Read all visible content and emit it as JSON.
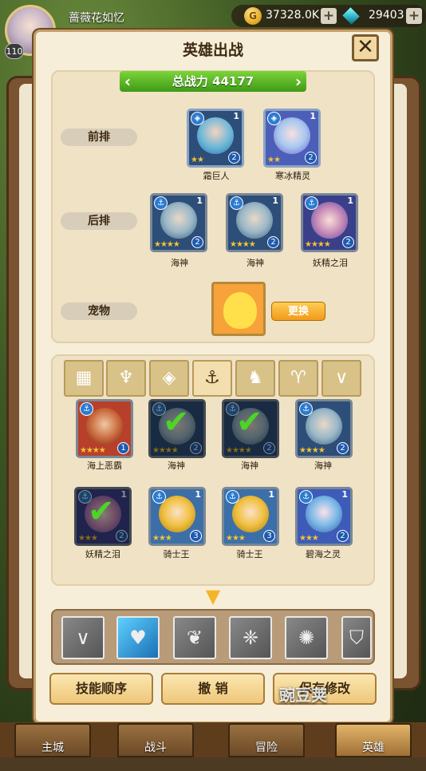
{
  "player": {
    "name": "蔷薇花如忆",
    "level": "110"
  },
  "resources": {
    "coin_icon": "G",
    "gold": "37328.0K",
    "gems": "29403",
    "plus": "+"
  },
  "dialog": {
    "title": "英雄出战",
    "close": "✕"
  },
  "team": {
    "power_label": "总战力  44177",
    "front_label": "前排",
    "back_label": "后排",
    "pet_label": "宠物",
    "front": [
      {
        "name": "霜巨人",
        "num": "1",
        "lv": "2"
      },
      {
        "name": "寒冰精灵",
        "num": "1",
        "lv": "2"
      }
    ],
    "back": [
      {
        "name": "海神",
        "num": "1",
        "lv": "2"
      },
      {
        "name": "海神",
        "num": "1",
        "lv": "2"
      },
      {
        "name": "妖精之泪",
        "num": "1",
        "lv": "2"
      }
    ],
    "swap_button": "更换"
  },
  "tabs": [
    "grid-icon",
    "leaf-icon",
    "diamond-icon",
    "anchor-icon",
    "wolf-icon",
    "horns-icon",
    "chevron-icon"
  ],
  "heroes": [
    {
      "name": "海上恶霸",
      "num": "",
      "lv": "1",
      "check": false
    },
    {
      "name": "海神",
      "num": "",
      "lv": "2",
      "check": true
    },
    {
      "name": "海神",
      "num": "",
      "lv": "2",
      "check": true
    },
    {
      "name": "海神",
      "num": "",
      "lv": "2",
      "check": false
    },
    {
      "name": "妖精之泪",
      "num": "1",
      "lv": "2",
      "check": true
    },
    {
      "name": "骑士王",
      "num": "1",
      "lv": "3",
      "check": false
    },
    {
      "name": "骑士王",
      "num": "1",
      "lv": "3",
      "check": false
    },
    {
      "name": "碧海之灵",
      "num": "1",
      "lv": "2",
      "check": false
    }
  ],
  "skills": [
    "chevron-skill-icon",
    "heart-skill-icon",
    "flame-skill-icon",
    "wings-skill-icon",
    "burst-skill-icon",
    "shield-skill-icon"
  ],
  "buttons": {
    "skill_order": "技能顺序",
    "cancel": "撤 销",
    "save": "保存修改"
  },
  "nav": {
    "city": "主城",
    "battle": "战斗",
    "adventure": "冒险",
    "hero": "英雄"
  },
  "watermark": "豌豆荚",
  "colors": {
    "accent": "#f29a1a",
    "power": "#3e9a16",
    "panel": "#f6eed8"
  }
}
